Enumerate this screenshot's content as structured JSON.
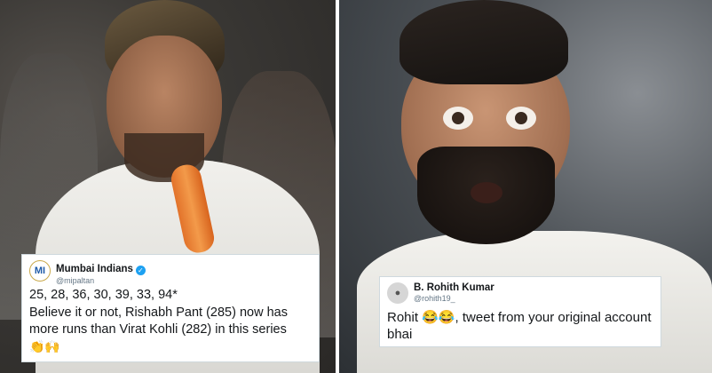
{
  "tweets": [
    {
      "display_name": "Mumbai Indians",
      "handle": "@mipaltan",
      "verified": true,
      "avatar_text": "MI",
      "line1": "25, 28, 36, 30, 39, 33, 94*",
      "line2": "Believe it or not, Rishabh Pant (285) now has more runs than Virat Kohli (282) in this series",
      "emojis": "👏🙌"
    },
    {
      "display_name": "B. Rohith Kumar",
      "handle": "@rohith19_",
      "verified": false,
      "avatar_text": "",
      "text_before": "Rohit ",
      "emojis": "😂😂",
      "text_after": ", tweet from your original account bhai"
    }
  ],
  "colors": {
    "verified_badge": "#1da1f2",
    "card_bg": "#ffffff",
    "divider": "#ffffff"
  }
}
